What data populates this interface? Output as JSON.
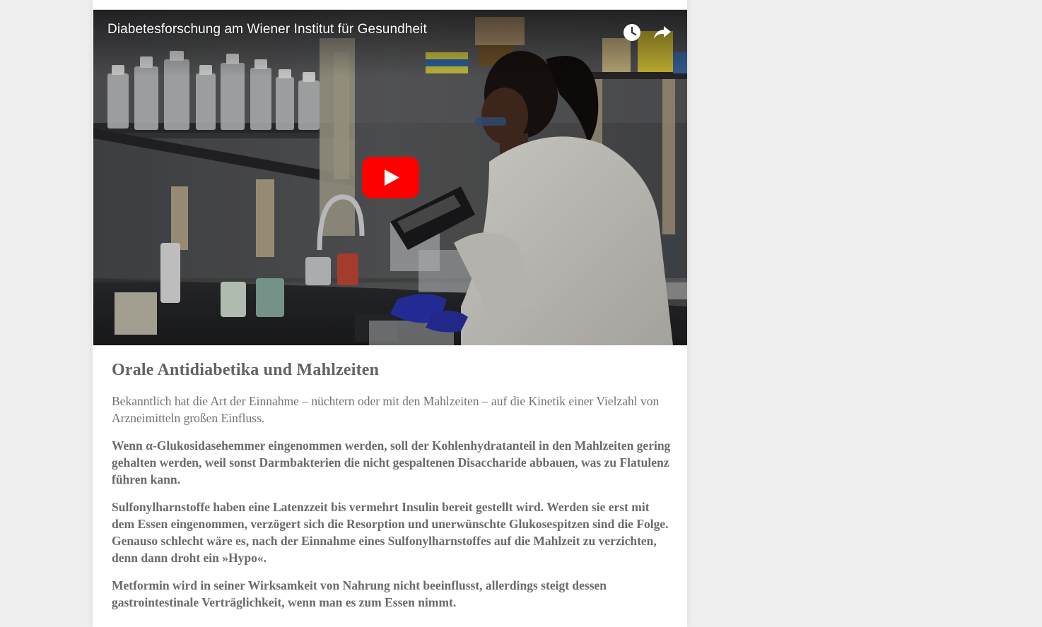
{
  "video": {
    "title": "Diabetesforschung am Wiener Institut für Gesundheit",
    "watch_later_icon": "clock-icon",
    "share_icon": "share-arrow-icon",
    "play_icon": "youtube-play-icon",
    "play_color": "#ff0000"
  },
  "article": {
    "heading": "Orale Antidiabetika und Mahlzeiten",
    "paragraphs": [
      "Bekanntlich hat die Art der Einnahme – nüchtern oder mit den Mahlzeiten – auf die Kinetik einer Vielzahl von Arzneimitteln großen Einfluss.",
      "Wenn α-Glukosidasehemmer eingenommen werden, soll der Kohlenhydratanteil in den Mahlzeiten gering gehalten werden, weil sonst Darmbakterien die nicht gespaltenen Disaccharide abbauen, was zu Flatulenz führen kann.",
      "Sulfonylharnstoffe haben eine Latenzzeit bis vermehrt Insulin bereit gestellt wird. Werden sie erst mit dem Essen eingenommen, verzögert sich die Resorption und unerwünschte Glukosespitzen sind die Folge. Genauso schlecht wäre es, nach der Einnahme eines Sulfonylharnstoffes auf die Mahlzeit zu verzichten, denn dann droht ein »Hypo«.",
      "Metformin wird in seiner Wirksamkeit von Nahrung nicht beeinflusst, allerdings steigt dessen gastrointestinale Verträglichkeit, wenn man es zum Essen nimmt."
    ]
  },
  "colors": {
    "page_background": "#efefef",
    "card_background": "#ffffff",
    "text": "#6c6c6c"
  }
}
